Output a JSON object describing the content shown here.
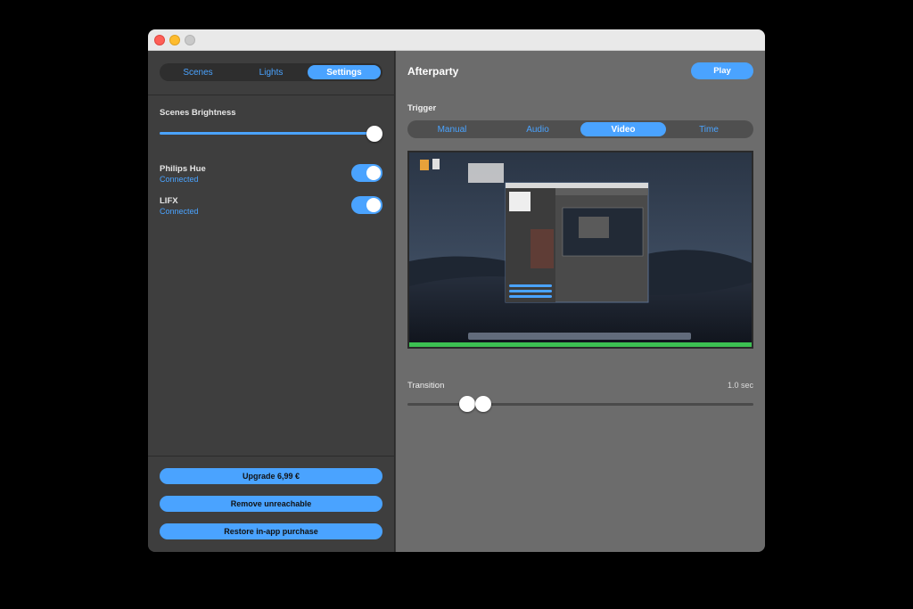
{
  "window": {
    "controls": [
      "close",
      "minimize",
      "zoom"
    ]
  },
  "sidebar": {
    "tabs": [
      {
        "label": "Scenes",
        "active": false
      },
      {
        "label": "Lights",
        "active": false
      },
      {
        "label": "Settings",
        "active": true
      }
    ],
    "brightness": {
      "label": "Scenes Brightness",
      "value_percent": 100
    },
    "integrations": [
      {
        "name": "Philips Hue",
        "status": "Connected",
        "enabled": true
      },
      {
        "name": "LIFX",
        "status": "Connected",
        "enabled": true
      }
    ],
    "buttons": {
      "upgrade": "Upgrade 6,99 €",
      "remove_unreachable": "Remove unreachable",
      "restore": "Restore in-app purchase"
    }
  },
  "main": {
    "title": "Afterparty",
    "play_label": "Play",
    "trigger": {
      "label": "Trigger",
      "tabs": [
        {
          "label": "Manual",
          "active": false
        },
        {
          "label": "Audio",
          "active": false
        },
        {
          "label": "Video",
          "active": true
        },
        {
          "label": "Time",
          "active": false
        }
      ]
    },
    "transition": {
      "label": "Transition",
      "value": "1.0 sec",
      "range_percent": [
        17,
        22
      ]
    }
  },
  "colors": {
    "accent": "#4aa3ff",
    "sidebar_bg": "#3e3e3e",
    "main_bg": "#6c6c6c"
  }
}
